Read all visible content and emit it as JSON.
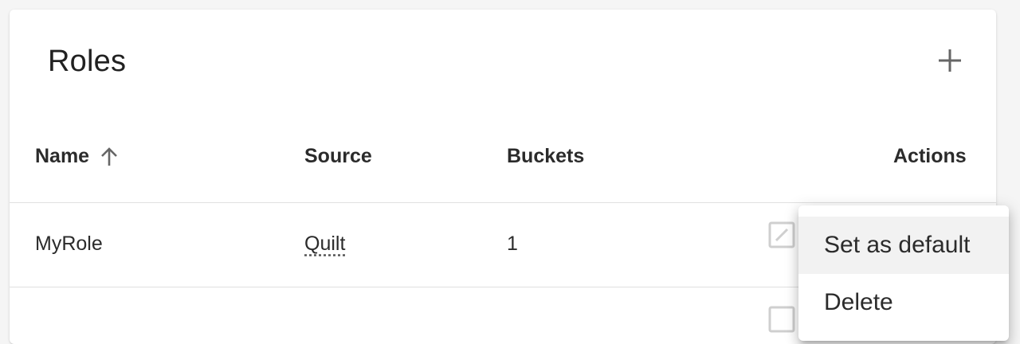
{
  "panel": {
    "title": "Roles"
  },
  "table": {
    "columns": {
      "name": "Name",
      "source": "Source",
      "buckets": "Buckets",
      "actions": "Actions"
    },
    "sort": {
      "column": "Name",
      "direction": "ascending"
    },
    "rows": [
      {
        "name": "MyRole",
        "source": "Quilt",
        "buckets": "1"
      }
    ]
  },
  "menu": {
    "items": [
      {
        "label": "Set as default",
        "highlighted": true
      },
      {
        "label": "Delete",
        "highlighted": false
      }
    ]
  },
  "icons": {
    "add": "plus-icon",
    "sort": "arrow-up-icon",
    "edit": "edit-icon"
  },
  "colors": {
    "background": "#f5f5f5",
    "card": "#ffffff",
    "text": "#212121",
    "icon": "#757575",
    "divider": "#e0e0e0",
    "menu_hover": "#f2f2f2"
  }
}
